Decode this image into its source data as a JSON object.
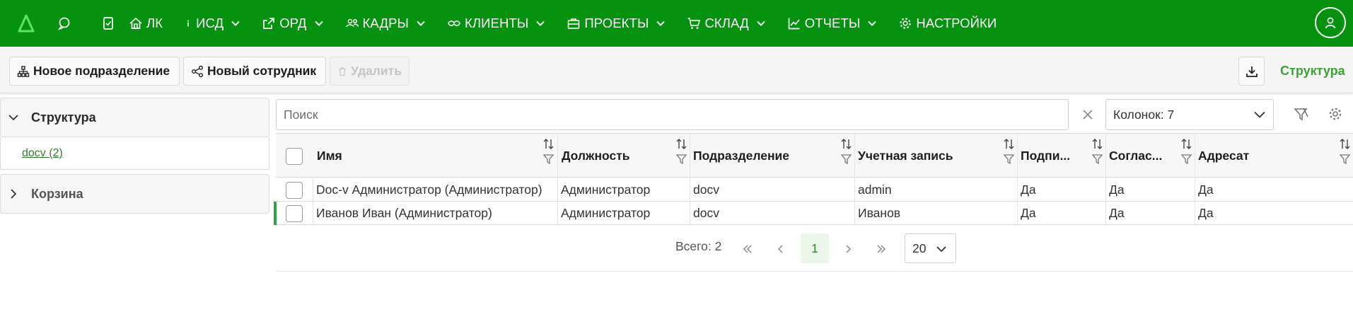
{
  "nav": {
    "items": [
      {
        "label": "ЛК",
        "icon": "home-icon",
        "has_menu": false
      },
      {
        "label": "ИСД",
        "icon": "info-icon",
        "has_menu": true
      },
      {
        "label": "ОРД",
        "icon": "external-link-icon",
        "has_menu": true
      },
      {
        "label": "КАДРЫ",
        "icon": "people-icon",
        "has_menu": true
      },
      {
        "label": "КЛИЕНТЫ",
        "icon": "handshake-icon",
        "has_menu": true
      },
      {
        "label": "ПРОЕКТЫ",
        "icon": "briefcase-icon",
        "has_menu": true
      },
      {
        "label": "СКЛАД",
        "icon": "cart-icon",
        "has_menu": true
      },
      {
        "label": "ОТЧЕТЫ",
        "icon": "chart-icon",
        "has_menu": true
      },
      {
        "label": "НАСТРОЙКИ",
        "icon": "gear-icon",
        "has_menu": false
      }
    ]
  },
  "toolbar": {
    "new_department": "Новое подразделение",
    "new_employee": "Новый сотрудник",
    "delete": "Удалить",
    "structure_link": "Структура"
  },
  "sidebar": {
    "structure_title": "Структура",
    "tree_item": "docv (2)",
    "trash_title": "Корзина"
  },
  "search": {
    "placeholder": "Поиск",
    "columns_label": "Колонок: 7"
  },
  "table": {
    "headers": [
      "Имя",
      "Должность",
      "Подразделение",
      "Учетная запись",
      "Подпи...",
      "Соглас...",
      "Адресат"
    ],
    "rows": [
      [
        "Doc-v Администратор (Администратор)",
        "Администратор",
        "docv",
        "admin",
        "Да",
        "Да",
        "Да"
      ],
      [
        "Иванов Иван (Администратор)",
        "Администратор",
        "docv",
        "Иванов",
        "Да",
        "Да",
        "Да"
      ]
    ]
  },
  "pager": {
    "total": "Всего: 2",
    "current_page": "1",
    "page_size": "20"
  },
  "colors": {
    "brand": "#04920f",
    "accent_link": "#3fa235"
  }
}
